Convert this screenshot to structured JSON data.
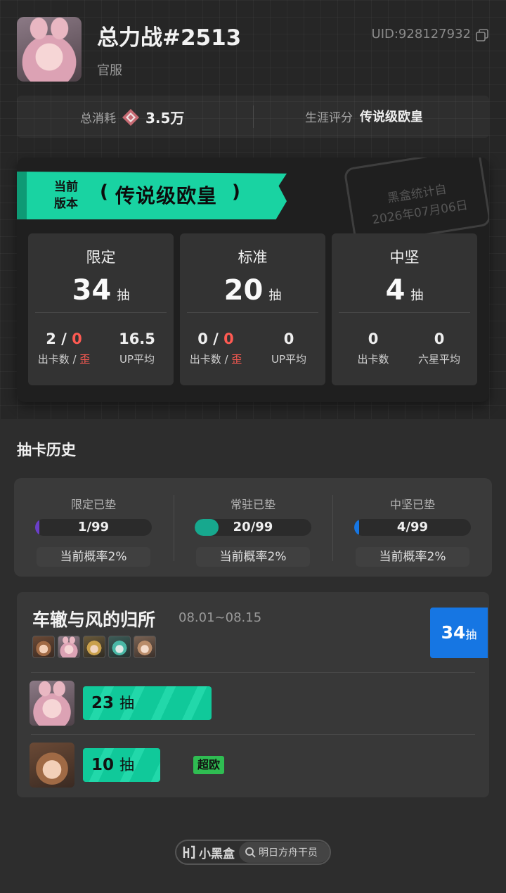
{
  "profile": {
    "name": "总力战#2513",
    "server": "官服",
    "uid": "UID:928127932",
    "avatar_icon": "bunny-girl-avatar"
  },
  "summary": {
    "spend_label": "总消耗",
    "spend_value": "3.5万",
    "spend_icon": "orundum-icon",
    "rating_label": "生涯评分",
    "rating_value": "传说级欧皇"
  },
  "banner": {
    "small_line1": "当前",
    "small_line2": "版本",
    "title": "传说级欧皇",
    "accent_color": "#19d3a2"
  },
  "stamp": {
    "line1": "黑盒统计自",
    "line2": "2026年07月06日"
  },
  "stats": [
    {
      "title": "限定",
      "count": "34",
      "unit": "抽",
      "left_a": "2",
      "left_sep": " / ",
      "left_b": "0",
      "left_label_a": "出卡数 / ",
      "left_label_b": "歪",
      "right_value": "16.5",
      "right_label": "UP平均"
    },
    {
      "title": "标准",
      "count": "20",
      "unit": "抽",
      "left_a": "0",
      "left_sep": " / ",
      "left_b": "0",
      "left_label_a": "出卡数 / ",
      "left_label_b": "歪",
      "right_value": "0",
      "right_label": "UP平均"
    },
    {
      "title": "中坚",
      "count": "4",
      "unit": "抽",
      "left_a": "0",
      "left_sep": "",
      "left_b": "",
      "left_label_a": "出卡数",
      "left_label_b": "",
      "right_value": "0",
      "right_label": "六星平均"
    }
  ],
  "history": {
    "title": "抽卡历史"
  },
  "pity": [
    {
      "label": "限定已垫",
      "value": "1/99",
      "fraction": 0.0101,
      "color": "#6a3fc8",
      "rate": "当前概率2%"
    },
    {
      "label": "常驻已垫",
      "value": "20/99",
      "fraction": 0.202,
      "color": "#17a88e",
      "rate": "当前概率2%"
    },
    {
      "label": "中坚已垫",
      "value": "4/99",
      "fraction": 0.0404,
      "color": "#1676e3",
      "rate": "当前概率2%"
    }
  ],
  "pool": {
    "name": "车辙与风的归所",
    "dates": "08.01~08.15",
    "total": "34",
    "total_unit": "抽",
    "total_color": "#1676e3",
    "featured_avatars": [
      "brown-hair-operator-avatar",
      "bunny-girl-avatar",
      "gold-hair-operator-avatar",
      "green-hair-operator-avatar",
      "tan-hair-operator-avatar"
    ],
    "pulls": [
      {
        "count": "23",
        "unit": "抽",
        "fraction": 0.676,
        "badge": "",
        "avatar": "bunny-girl-avatar"
      },
      {
        "count": "10",
        "unit": "抽",
        "fraction": 0.294,
        "badge": "超欧",
        "avatar": "brown-hair-operator-avatar"
      }
    ]
  },
  "footer": {
    "brand": "小黑盒",
    "search_text": "明日方舟干员"
  }
}
